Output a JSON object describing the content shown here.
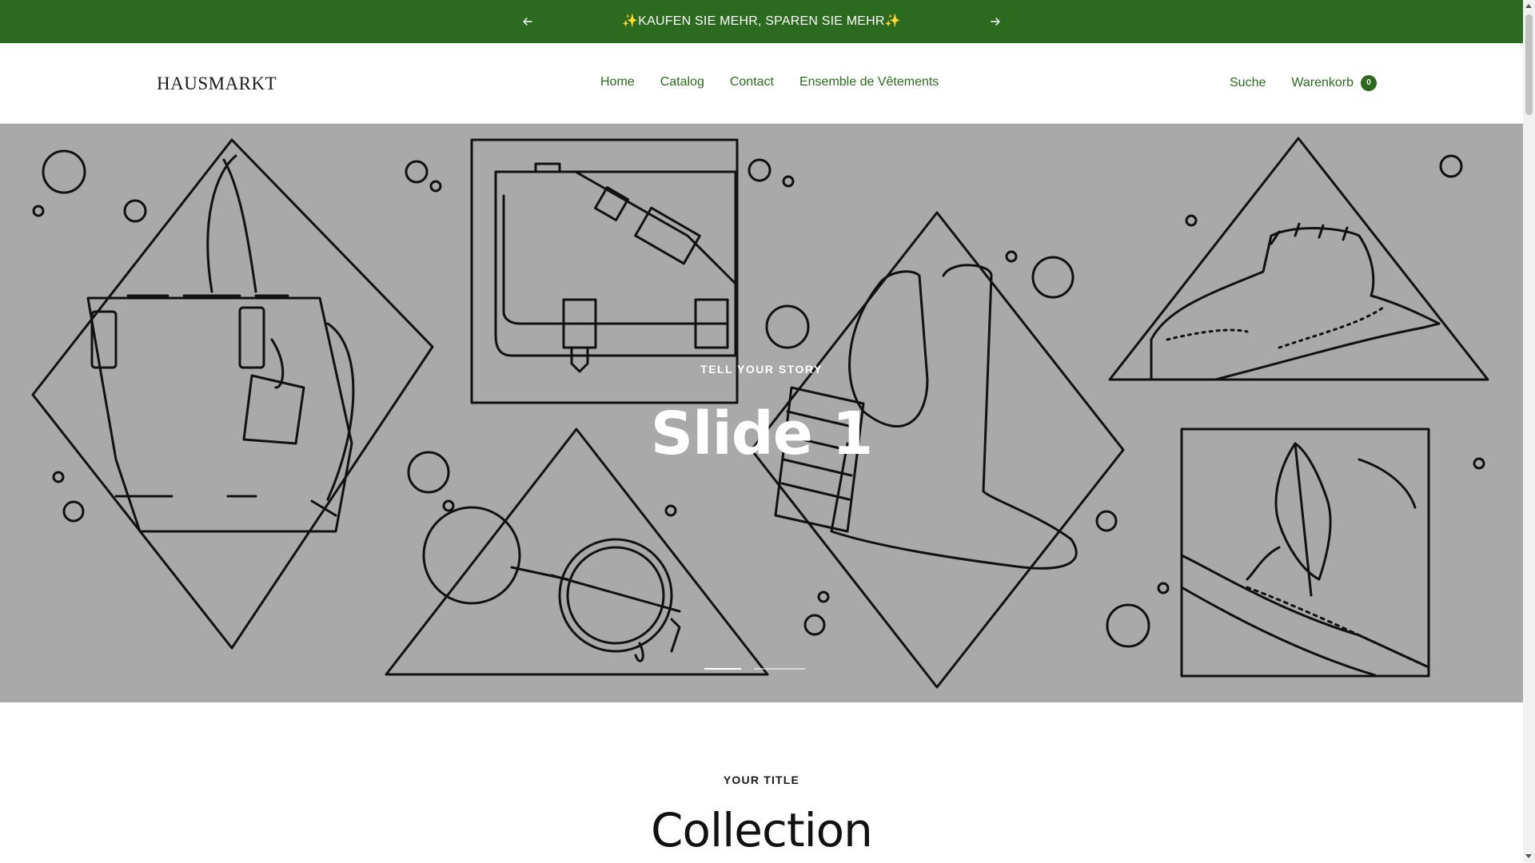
{
  "announcement": {
    "text": "✨KAUFEN SIE MEHR, SPAREN SIE MEHR✨",
    "prev_icon": "arrow-left-icon",
    "next_icon": "arrow-right-icon"
  },
  "header": {
    "logo": "HAUSMARKT",
    "nav": [
      "Home",
      "Catalog",
      "Contact",
      "Ensemble de Vêtements"
    ],
    "search_label": "Suche",
    "cart_label": "Warenkorb",
    "cart_count": "0"
  },
  "hero": {
    "subheading": "TELL YOUR STORY",
    "title": "Slide 1",
    "slide_count": 2,
    "active_slide": 1
  },
  "section": {
    "subheading": "YOUR TITLE",
    "title": "Collection"
  },
  "colors": {
    "brand_green": "#2b6a1f",
    "hero_bg": "#a9a9a9"
  }
}
